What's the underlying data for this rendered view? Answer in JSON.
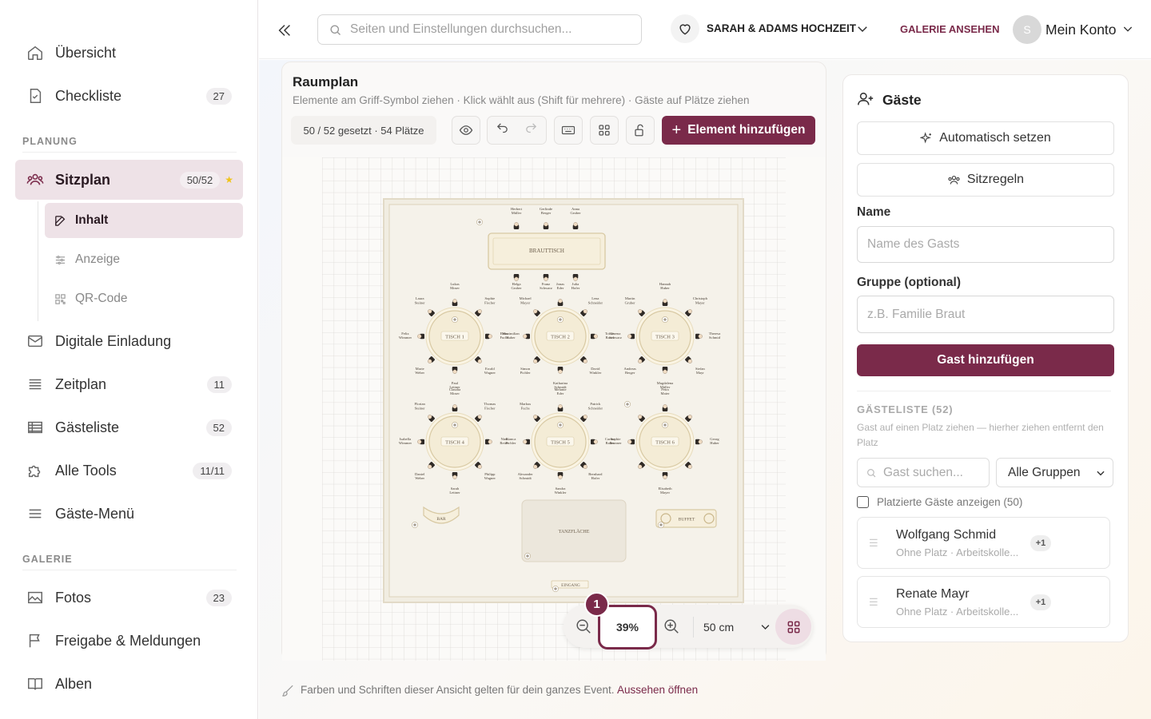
{
  "sidebar": {
    "items": [
      {
        "label": "Übersicht",
        "badge": ""
      },
      {
        "label": "Checkliste",
        "badge": "27"
      },
      {
        "label": "Sitzplan",
        "badge": "50/52"
      },
      {
        "label": "Digitale Einladung",
        "badge": ""
      },
      {
        "label": "Zeitplan",
        "badge": "11"
      },
      {
        "label": "Gästeliste",
        "badge": "52"
      },
      {
        "label": "Alle Tools",
        "badge": "11/11"
      },
      {
        "label": "Gäste-Menü",
        "badge": ""
      },
      {
        "label": "Fotos",
        "badge": "23"
      },
      {
        "label": "Freigabe & Meldungen",
        "badge": ""
      },
      {
        "label": "Alben",
        "badge": ""
      }
    ],
    "sections": {
      "planung": "PLANUNG",
      "galerie": "GALERIE"
    },
    "sub_items": [
      {
        "label": "Inhalt"
      },
      {
        "label": "Anzeige"
      },
      {
        "label": "QR-Code"
      }
    ]
  },
  "header": {
    "search_placeholder": "Seiten und Einstellungen durchsuchen...",
    "event_name": "SARAH & ADAMS HOCHZEIT",
    "gallery_link": "GALERIE ANSEHEN",
    "avatar_initial": "S",
    "account_label": "Mein Konto"
  },
  "plan": {
    "title": "Raumplan",
    "subtitle": "Elemente am Griff-Symbol ziehen · Klick wählt aus (Shift für mehrere) · Gäste auf Plätze ziehen",
    "status": "50 / 52 gesetzt · 54 Plätze",
    "add_element": "Element hinzufügen",
    "zoom": "39%",
    "zoom_badge": "1",
    "grid_size": "50 cm",
    "footer_note": "Farben und Schriften dieser Ansicht gelten für dein ganzes Event.",
    "footer_link": "Aussehen öffnen",
    "head_table": {
      "label": "BRAUTTISCH",
      "guests_top": [
        "Herbert Müller",
        "Gerlinde Berger",
        "Anna Gruber"
      ],
      "guests_bottom": [
        "Helga Gruber",
        "Franz Schwarz",
        "Julia Hofer"
      ]
    },
    "tables": [
      {
        "label": "TISCH 1",
        "guests": [
          "Lukas Moser",
          "Sophie Fischer",
          "Elena Fuchs",
          "Ewald Wagner",
          "Paul Lettner",
          "Marie Weber",
          "Felix Wimmer",
          "Laura Steiner"
        ]
      },
      {
        "label": "TISCH 2",
        "guests": [
          "Jonas Eder",
          "Lena Schneider",
          "Tobias Bauer",
          "David Winkler",
          "Katharina Schmidt",
          "Simon Pichler",
          "Maximilian Huber",
          "Michael Mayer"
        ]
      },
      {
        "label": "TISCH 3",
        "guests": [
          "Hannah Huber",
          "Christoph Mayer",
          "Theresa Schmid",
          "Stefan Mayr",
          "Magdalena Müller",
          "Andreas Berger",
          "Verena Schwarz",
          "Martin Gruber"
        ]
      },
      {
        "label": "TISCH 4",
        "guests": [
          "Claudia Moser",
          "Thomas Fischer",
          "Nina Reiter",
          "Philipp Wagner",
          "Sarah Lettner",
          "Daniel Weber",
          "Isabella Wimmer",
          "Florian Steiner"
        ]
      },
      {
        "label": "TISCH 5",
        "guests": [
          "Melanie Eder",
          "Patrick Schneider",
          "Carina Bauer",
          "Bernhard Hofer",
          "Sandra Winkler",
          "Alexander Schmidt",
          "Bianca Pichler",
          "Markus Fuchs"
        ]
      },
      {
        "label": "TISCH 6",
        "guests": [
          "Petra Maier",
          "Georg Huber",
          "Elisabeth Mayer",
          "Sophie Brunner"
        ]
      }
    ],
    "bar_label": "BAR",
    "buffet_label": "BUFFET",
    "dance_label": "TANZFLÄCHE",
    "entrance_label": "EINGANG"
  },
  "guests_panel": {
    "title": "Gäste",
    "auto_button": "Automatisch setzen",
    "rules_button": "Sitzregeln",
    "name_label": "Name",
    "name_placeholder": "Name des Gasts",
    "group_label": "Gruppe (optional)",
    "group_placeholder": "z.B. Familie Braut",
    "add_button": "Gast hinzufügen",
    "list_title": "GÄSTELISTE (52)",
    "list_hint": "Gast auf einen Platz ziehen — hierher ziehen entfernt den Platz",
    "search_placeholder": "Gast suchen...",
    "group_filter": "Alle Gruppen",
    "show_placed_label": "Platzierte Gäste anzeigen (50)",
    "guests": [
      {
        "name": "Wolfgang Schmid",
        "meta": "Ohne Platz · Arbeitskolle...",
        "plus": "+1"
      },
      {
        "name": "Renate Mayr",
        "meta": "Ohne Platz · Arbeitskolle...",
        "plus": "+1"
      }
    ]
  },
  "colors": {
    "accent": "#7a2a4a",
    "active_bg": "#eee2e7",
    "gold": "#d8c9a3"
  }
}
